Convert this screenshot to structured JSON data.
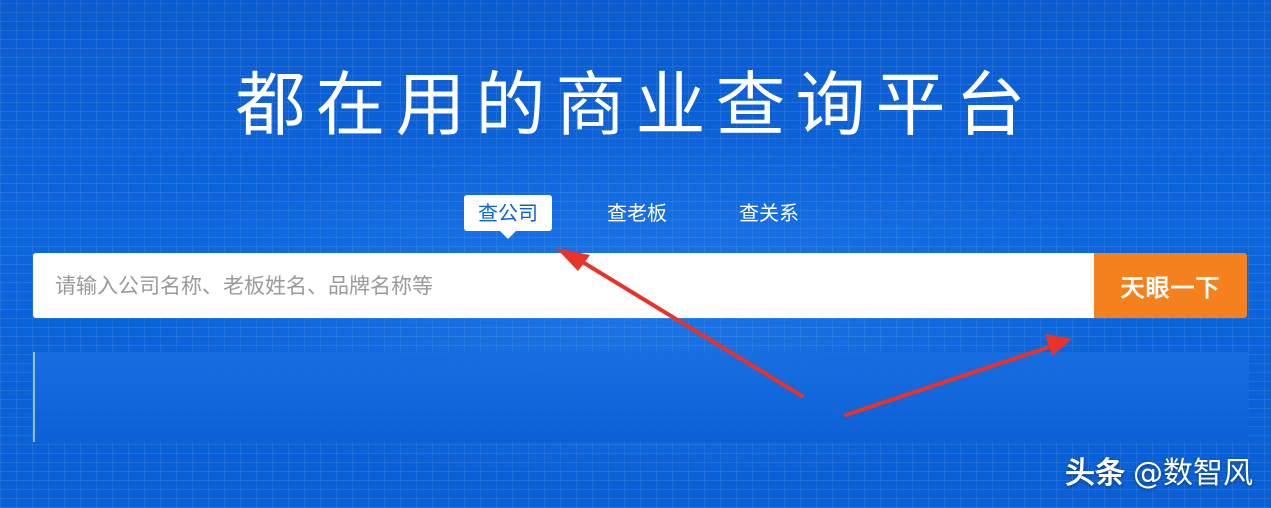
{
  "hero": {
    "headline": "都在用的商业查询平台"
  },
  "tabs": [
    {
      "label": "查公司",
      "active": true
    },
    {
      "label": "查老板",
      "active": false
    },
    {
      "label": "查关系",
      "active": false
    }
  ],
  "search": {
    "placeholder": "请输入公司名称、老板姓名、品牌名称等",
    "value": "",
    "button_label": "天眼一下"
  },
  "watermark": {
    "brand": "头条",
    "handle": "@数智风"
  },
  "colors": {
    "background": "#0a5fd4",
    "accent_button": "#f5801e",
    "annotation_arrow": "#e8322a",
    "active_tab_text": "#0a62d8"
  },
  "annotations": {
    "arrows": [
      "red-arrow-to-active-tab",
      "red-arrow-to-search-button"
    ]
  }
}
